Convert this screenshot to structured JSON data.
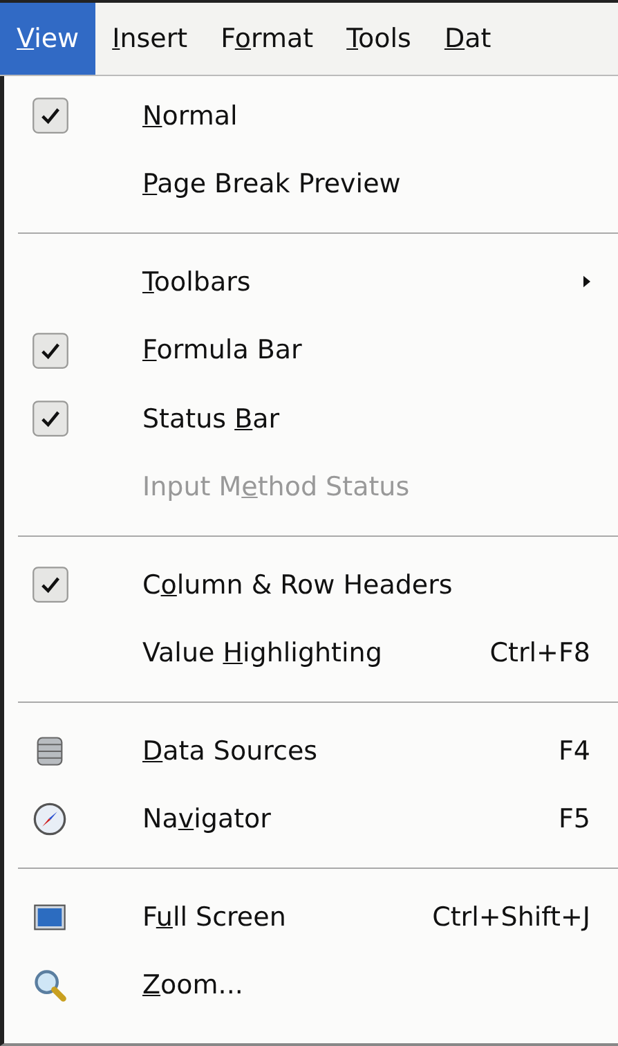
{
  "menubar": [
    {
      "key": "V",
      "post": "iew",
      "selected": true
    },
    {
      "key": "I",
      "post": "nsert",
      "selected": false
    },
    {
      "pre": "F",
      "key": "o",
      "post": "rmat",
      "selected": false
    },
    {
      "key": "T",
      "post": "ools",
      "selected": false
    },
    {
      "key": "D",
      "post": "at",
      "selected": false
    }
  ],
  "menu": [
    {
      "kind": "item",
      "key": "N",
      "post": "ormal",
      "checked": true,
      "disabled": false
    },
    {
      "kind": "item",
      "key": "P",
      "post": "age Break Preview",
      "checked": false,
      "disabled": false
    },
    {
      "kind": "separator"
    },
    {
      "kind": "item",
      "key": "T",
      "post": "oolbars",
      "checked": false,
      "disabled": false,
      "submenu": true
    },
    {
      "kind": "item",
      "key": "F",
      "post": "ormula Bar",
      "checked": true,
      "disabled": false
    },
    {
      "kind": "item",
      "pre": "Status ",
      "key": "B",
      "post": "ar",
      "checked": true,
      "disabled": false
    },
    {
      "kind": "item",
      "pre": "Input M",
      "key": "e",
      "post": "thod Status",
      "checked": false,
      "disabled": true
    },
    {
      "kind": "separator"
    },
    {
      "kind": "item",
      "pre": "C",
      "key": "o",
      "post": "lumn & Row Headers",
      "checked": true,
      "disabled": false
    },
    {
      "kind": "item",
      "pre": "Value ",
      "key": "H",
      "post": "ighlighting",
      "checked": false,
      "disabled": false,
      "shortcut": "Ctrl+F8"
    },
    {
      "kind": "separator"
    },
    {
      "kind": "iconitem",
      "key": "D",
      "post": "ata Sources",
      "disabled": false,
      "shortcut": "F4"
    },
    {
      "kind": "iconitem",
      "pre": "Na",
      "key": "v",
      "post": "igator",
      "disabled": false,
      "shortcut": "F5"
    },
    {
      "kind": "separator"
    },
    {
      "kind": "iconitem",
      "pre": "F",
      "key": "u",
      "post": "ll Screen",
      "disabled": false,
      "shortcut": "Ctrl+Shift+J"
    },
    {
      "kind": "iconitem",
      "key": "Z",
      "post": "oom...",
      "disabled": false
    }
  ]
}
